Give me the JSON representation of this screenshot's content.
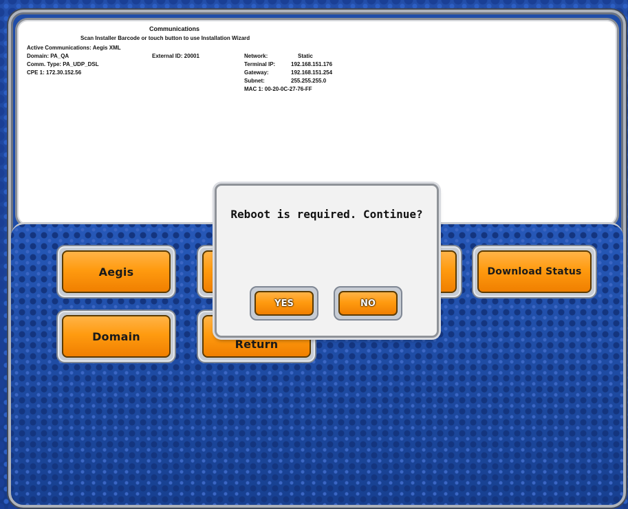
{
  "info": {
    "title": "Communications",
    "instruction": "Scan Installer Barcode or touch button to use Installation Wizard",
    "active_comm": "Active Communications: Aegis XML",
    "domain": "Domain: PA_QA",
    "external_id": "External ID: 20001",
    "comm_type": "Comm. Type: PA_UDP_DSL",
    "cpe": "CPE 1: 172.30.152.56",
    "network_label": "Network:",
    "network_value": "Static",
    "terminal_ip_label": "Terminal IP:",
    "terminal_ip_value": "192.168.151.176",
    "gateway_label": "Gateway:",
    "gateway_value": "192.168.151.254",
    "subnet_label": "Subnet:",
    "subnet_value": "255.255.255.0",
    "mac": "MAC 1: 00-20-0C-27-76-FF"
  },
  "buttons": {
    "aegis": "Aegis",
    "domain": "Domain",
    "return": "Return",
    "download_status": "Download Status"
  },
  "dialog": {
    "message": "Reboot is required.  Continue?",
    "yes": "YES",
    "no": "NO"
  }
}
